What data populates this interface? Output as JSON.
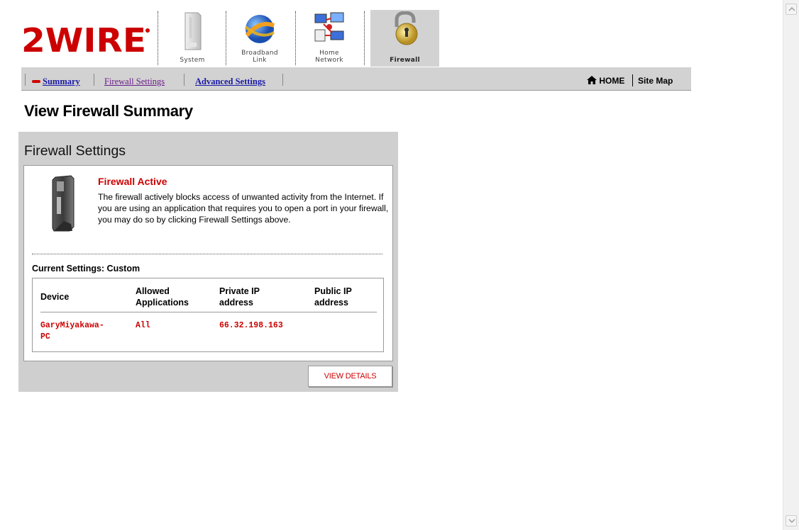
{
  "brand": {
    "logo_text": "2WIRE"
  },
  "top_nav": {
    "items": [
      {
        "label": "System",
        "icon": "system-device-icon",
        "active": false
      },
      {
        "label": "Broadband\nLink",
        "icon": "globe-icon",
        "active": false
      },
      {
        "label": "Home\nNetwork",
        "icon": "home-network-icon",
        "active": false
      },
      {
        "label": "Firewall",
        "icon": "padlock-icon",
        "active": true
      }
    ]
  },
  "sub_nav": {
    "items": [
      {
        "label": "Summary",
        "current": true
      },
      {
        "label": "Firewall Settings",
        "visited": true
      },
      {
        "label": "Advanced Settings"
      }
    ],
    "home_label": "HOME",
    "sitemap_label": "Site Map"
  },
  "page": {
    "title": "View Firewall Summary"
  },
  "panel": {
    "title": "Firewall Settings",
    "status_title": "Firewall Active",
    "description": "The firewall actively blocks access of unwanted activity from the Internet. If you are using an application that requires you to open a port in your firewall, you may do so by clicking Firewall Settings above.",
    "current_settings": "Current Settings: Custom",
    "table": {
      "headers": [
        "Device",
        "Allowed Applications",
        "Private IP address",
        "Public IP address"
      ],
      "rows": [
        {
          "device": "GaryMiyakawa-PC",
          "allowed": "All",
          "private_ip": "66.32.198.163",
          "public_ip": ""
        }
      ]
    },
    "button_label": "VIEW DETAILS"
  },
  "colors": {
    "accent_red": "#cc0000",
    "panel_gray": "#cfcfcf",
    "link_blue": "#1a1aa6"
  }
}
